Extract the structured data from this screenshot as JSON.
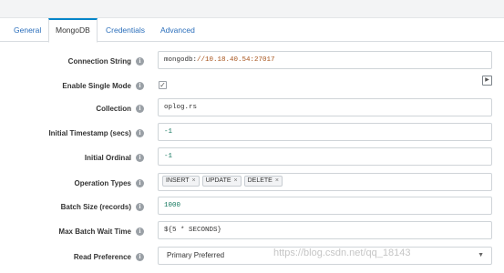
{
  "tabs": [
    {
      "label": "General"
    },
    {
      "label": "MongoDB"
    },
    {
      "label": "Credentials"
    },
    {
      "label": "Advanced"
    }
  ],
  "fields": {
    "connection_string": {
      "label": "Connection String",
      "prefix": "mongodb:",
      "value": "//10.18.40.54:27017"
    },
    "enable_single_mode": {
      "label": "Enable Single Mode",
      "checked": true
    },
    "collection": {
      "label": "Collection",
      "value": "oplog.rs"
    },
    "initial_timestamp": {
      "label": "Initial Timestamp (secs)",
      "value": "-1"
    },
    "initial_ordinal": {
      "label": "Initial Ordinal",
      "value": "-1"
    },
    "operation_types": {
      "label": "Operation Types",
      "tags": [
        "INSERT",
        "UPDATE",
        "DELETE"
      ]
    },
    "batch_size": {
      "label": "Batch Size (records)",
      "value": "1000"
    },
    "max_batch_wait": {
      "label": "Max Batch Wait Time",
      "value": "${5 * SECONDS}"
    },
    "read_preference": {
      "label": "Read Preference",
      "value": "Primary Preferred"
    }
  },
  "icons": {
    "info": "info-icon",
    "check": "check-icon",
    "side": "expand-panel-icon",
    "remove": "remove-tag-icon",
    "dropdown": "chevron-down-icon"
  },
  "watermark": "https://blog.csdn.net/qq_18143"
}
